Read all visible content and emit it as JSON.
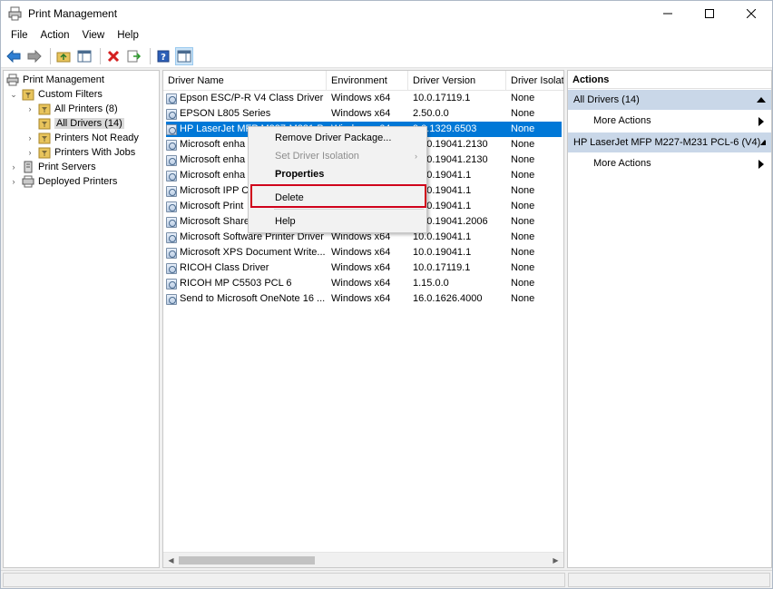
{
  "window": {
    "title": "Print Management"
  },
  "menubar": {
    "items": [
      "File",
      "Action",
      "View",
      "Help"
    ]
  },
  "tree": {
    "root": "Print Management",
    "items": [
      {
        "label": "Custom Filters"
      },
      {
        "label": "All Printers (8)"
      },
      {
        "label": "All Drivers (14)"
      },
      {
        "label": "Printers Not Ready"
      },
      {
        "label": "Printers With Jobs"
      },
      {
        "label": "Print Servers"
      },
      {
        "label": "Deployed Printers"
      }
    ]
  },
  "list": {
    "columns": [
      "Driver Name",
      "Environment",
      "Driver Version",
      "Driver Isolati"
    ],
    "rows": [
      {
        "name": "Epson ESC/P-R V4 Class Driver",
        "env": "Windows x64",
        "ver": "10.0.17119.1",
        "iso": "None"
      },
      {
        "name": "EPSON L805 Series",
        "env": "Windows x64",
        "ver": "2.50.0.0",
        "iso": "None"
      },
      {
        "name": "HP LaserJet MFP M227-M231 P",
        "env": "Windows x64",
        "ver": "9.0.1329.6503",
        "iso": "None"
      },
      {
        "name": "Microsoft enha",
        "env": "Windows x64",
        "ver": "10.0.19041.2130",
        "iso": "None"
      },
      {
        "name": "Microsoft enha",
        "env": "Windows x64",
        "ver": "10.0.19041.2130",
        "iso": "None"
      },
      {
        "name": "Microsoft enha",
        "env": "Windows x64",
        "ver": "10.0.19041.1",
        "iso": "None"
      },
      {
        "name": "Microsoft IPP C",
        "env": "Windows x64",
        "ver": "10.0.19041.1",
        "iso": "None"
      },
      {
        "name": "Microsoft Print",
        "env": "Windows x64",
        "ver": "10.0.19041.1",
        "iso": "None"
      },
      {
        "name": "Microsoft Share",
        "env": "Windows x64",
        "ver": "10.0.19041.2006",
        "iso": "None"
      },
      {
        "name": "Microsoft Software Printer Driver",
        "env": "Windows x64",
        "ver": "10.0.19041.1",
        "iso": "None"
      },
      {
        "name": "Microsoft XPS Document Write...",
        "env": "Windows x64",
        "ver": "10.0.19041.1",
        "iso": "None"
      },
      {
        "name": "RICOH Class Driver",
        "env": "Windows x64",
        "ver": "10.0.17119.1",
        "iso": "None"
      },
      {
        "name": "RICOH MP C5503 PCL 6",
        "env": "Windows x64",
        "ver": "1.15.0.0",
        "iso": "None"
      },
      {
        "name": "Send to Microsoft OneNote 16 ...",
        "env": "Windows x64",
        "ver": "16.0.1626.4000",
        "iso": "None"
      }
    ]
  },
  "context_menu": {
    "remove_package": "Remove Driver Package...",
    "set_isolation": "Set Driver Isolation",
    "properties": "Properties",
    "delete": "Delete",
    "help": "Help"
  },
  "actions": {
    "title": "Actions",
    "section1": "All Drivers (14)",
    "more1": "More Actions",
    "section2": "HP LaserJet MFP M227-M231 PCL-6 (V4)",
    "more2": "More Actions"
  },
  "colors": {
    "selection": "#0078d7",
    "highlight_box": "#d0021b",
    "action_section": "#c9d7e8"
  }
}
